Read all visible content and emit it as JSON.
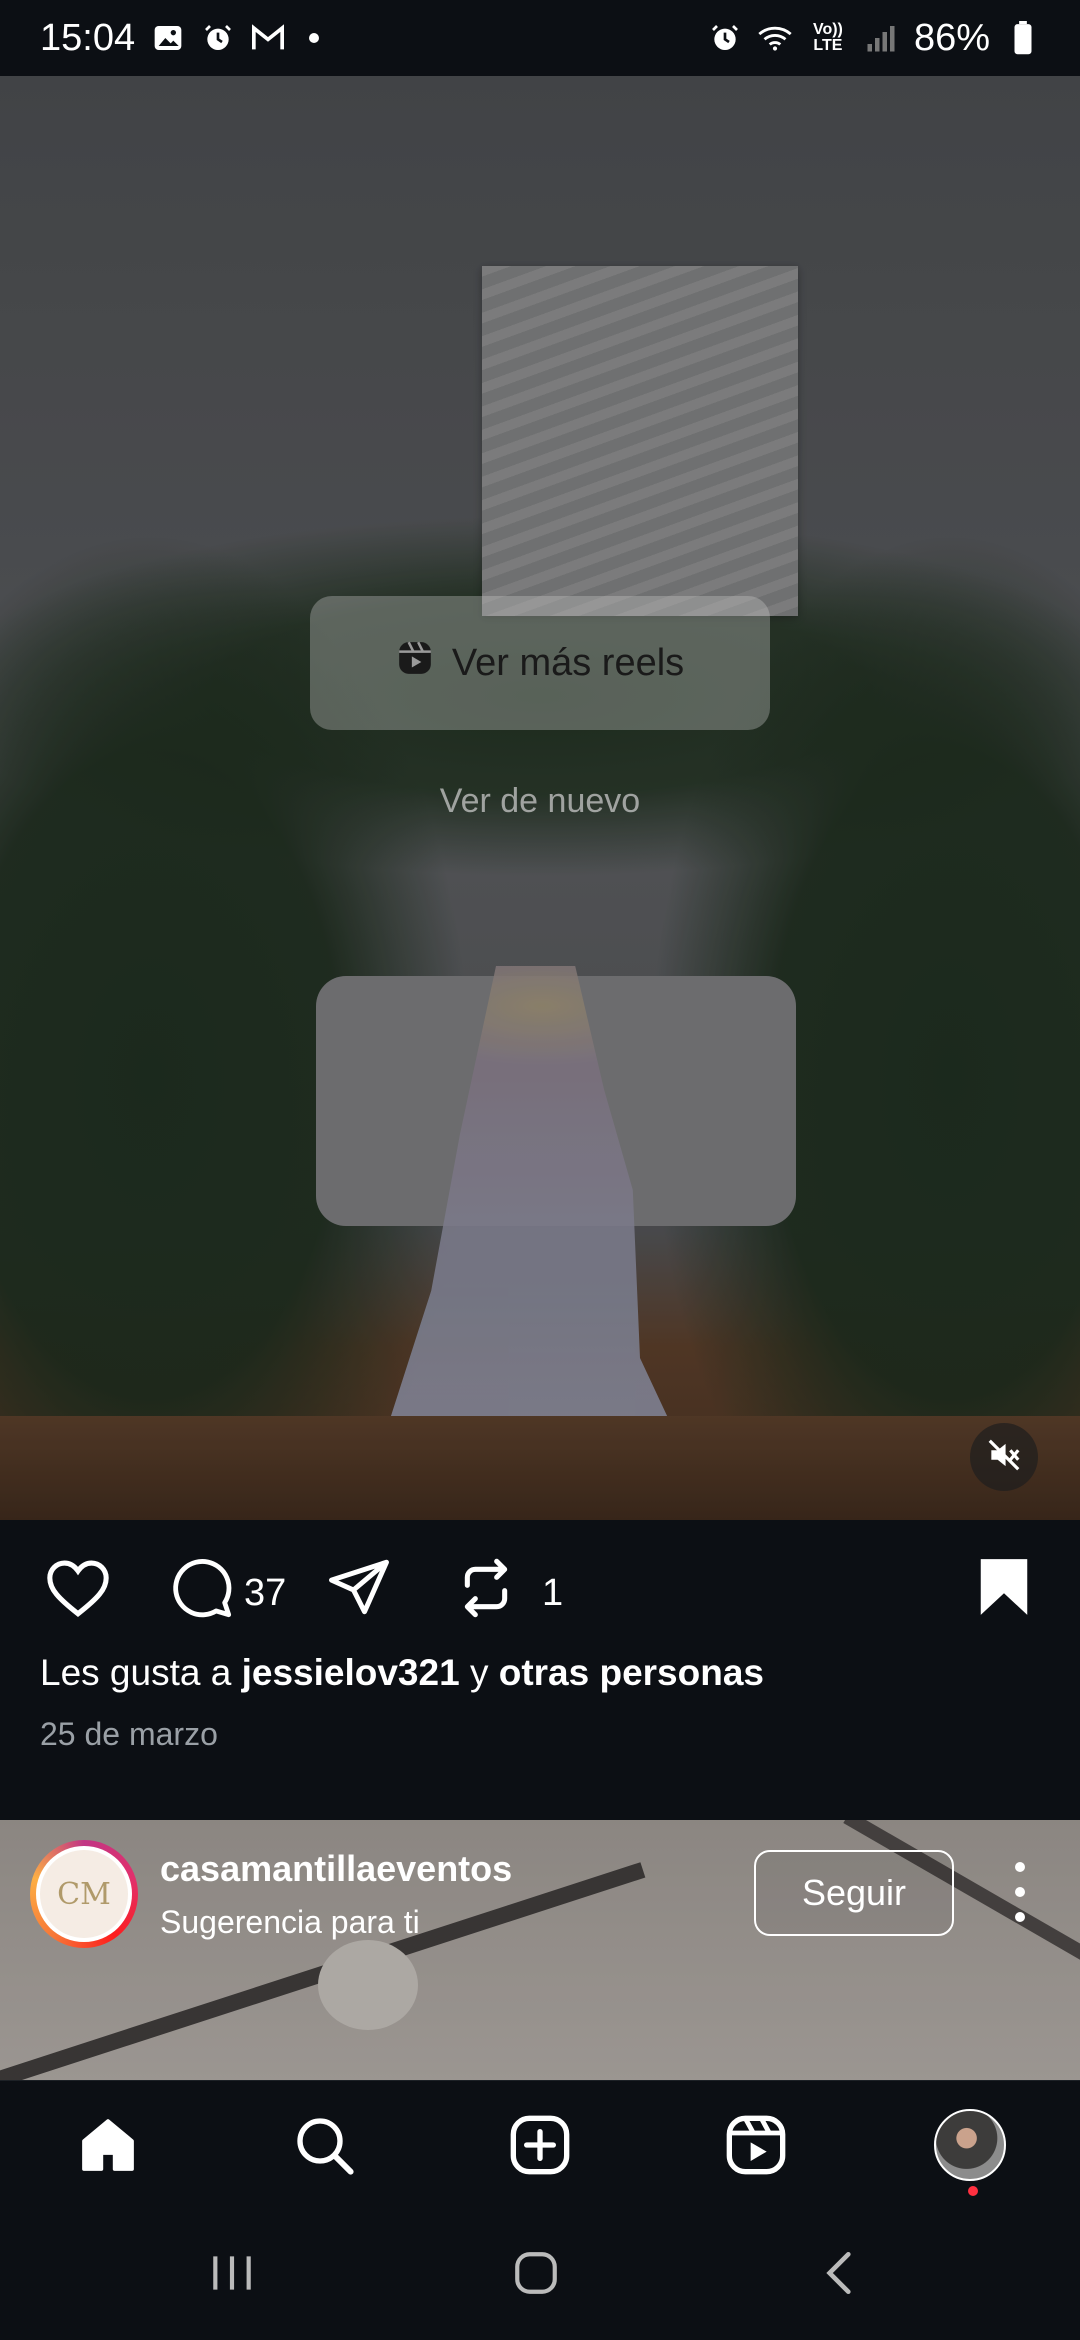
{
  "status_bar": {
    "time": "15:04",
    "battery": "86%",
    "icons_left": [
      "image-icon",
      "alarm-icon",
      "gmail-icon",
      "dot"
    ],
    "icons_right": [
      "alarm-icon",
      "wifi-icon",
      "volte-icon",
      "signal-icon",
      "battery-icon"
    ],
    "volte_label": "Vo)) LTE"
  },
  "reel": {
    "more_reels_label": "Ver más reels",
    "watch_again_label": "Ver de nuevo",
    "muted": true
  },
  "actions": {
    "comments_count": "37",
    "reposts_count": "1",
    "saved": true
  },
  "likes": {
    "prefix": "Les gusta a",
    "user": "jessielov321",
    "joiner": "y",
    "others": "otras personas"
  },
  "date": "25 de marzo",
  "suggestion": {
    "username": "casamantillaeventos",
    "subtitle": "Sugerencia para ti",
    "follow_label": "Seguir",
    "logo_text": "CM"
  },
  "bottom_nav": {
    "items": [
      "home-icon",
      "search-icon",
      "create-icon",
      "reels-icon",
      "profile-avatar"
    ],
    "notification_dot": true
  },
  "colors": {
    "background": "#0c0f14",
    "text": "#ffffff",
    "muted_text": "#9aa0a6",
    "notification": "#ff3040"
  }
}
